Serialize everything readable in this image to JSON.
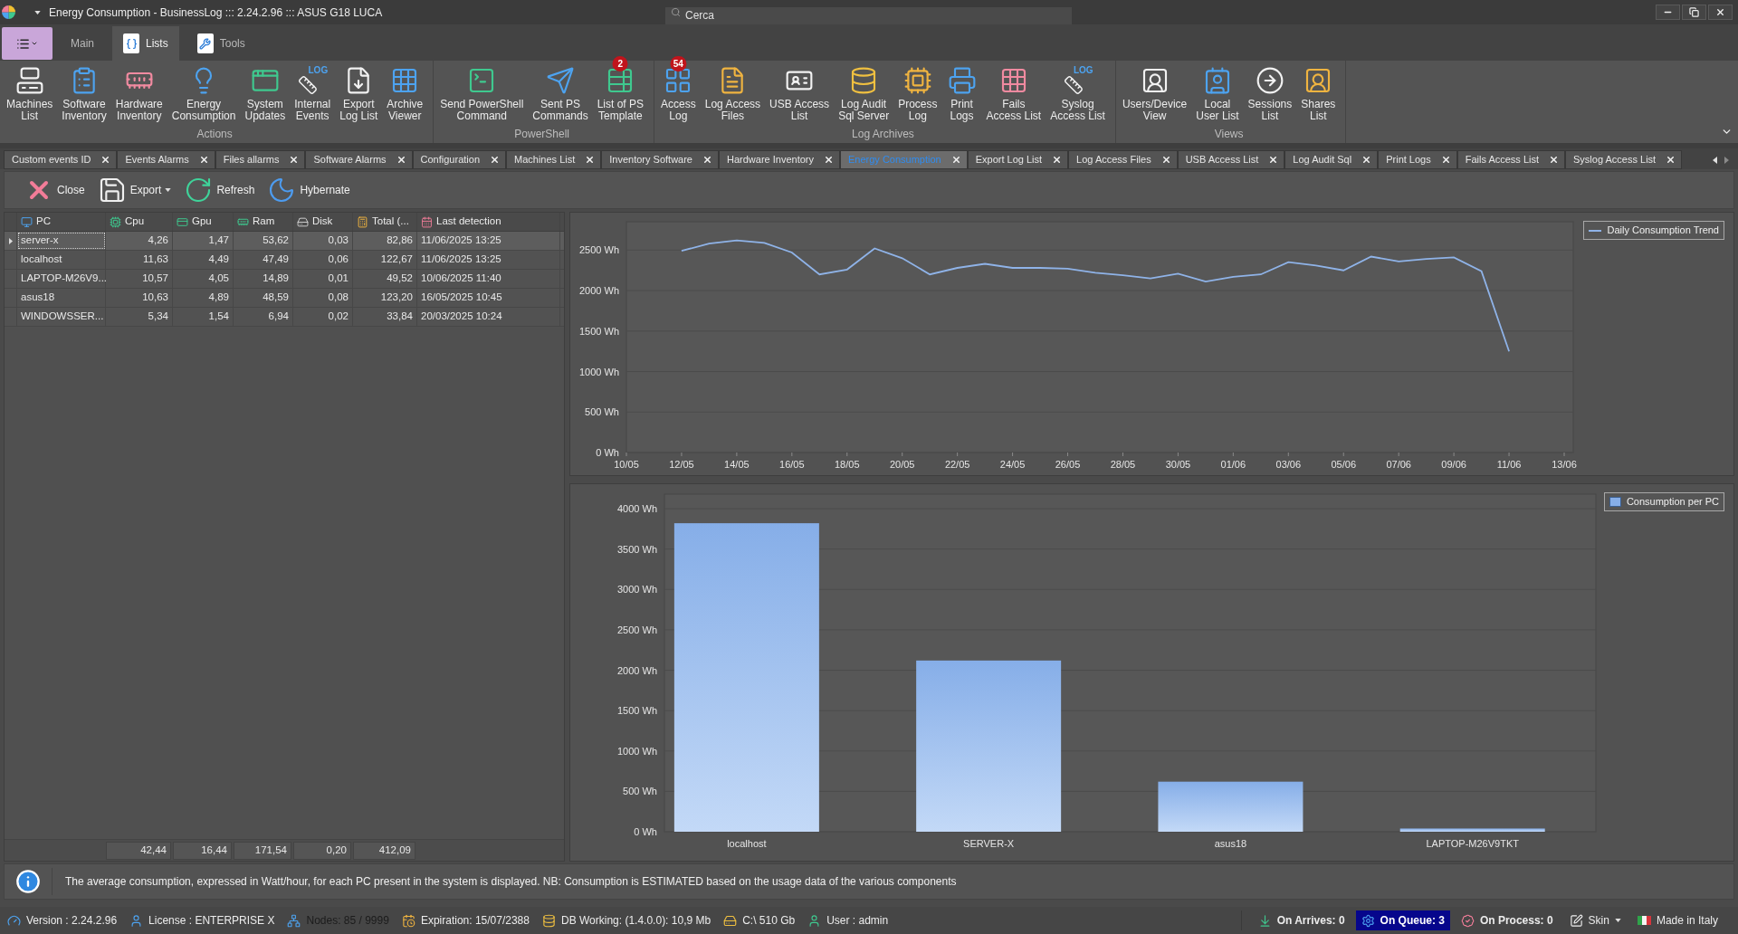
{
  "window": {
    "title": "Energy Consumption - BusinessLog ::: 2.24.2.96 ::: ASUS G18 LUCA",
    "search": {
      "placeholder": "Cerca"
    }
  },
  "ribbon": {
    "tabs": [
      {
        "label": "Main",
        "selected": false
      },
      {
        "label": "Lists",
        "selected": true
      },
      {
        "label": "Tools",
        "selected": false
      }
    ],
    "groups": [
      {
        "label": "Actions",
        "items": [
          {
            "label": "Machines\nList"
          },
          {
            "label": "Software\nInventory"
          },
          {
            "label": "Hardware\nInventory"
          },
          {
            "label": "Energy\nConsumption"
          },
          {
            "label": "System\nUpdates"
          },
          {
            "label": "Internal\nEvents",
            "icon_caption": "LOG"
          },
          {
            "label": "Export\nLog List"
          },
          {
            "label": "Archive\nViewer"
          }
        ]
      },
      {
        "label": "PowerShell",
        "items": [
          {
            "label": "Send PowerShell\nCommand"
          },
          {
            "label": "Sent PS\nCommands"
          },
          {
            "label": "List of PS\nTemplate",
            "badge": "2"
          }
        ]
      },
      {
        "label": "Log Archives",
        "items": [
          {
            "label": "Access\nLog",
            "badge": "54"
          },
          {
            "label": "Log Access\nFiles"
          },
          {
            "label": "USB Access\nList"
          },
          {
            "label": "Log Audit\nSql Server"
          },
          {
            "label": "Process\nLog"
          },
          {
            "label": "Print\nLogs"
          },
          {
            "label": "Fails\nAccess List"
          },
          {
            "label": "Syslog\nAccess List",
            "icon_caption": "LOG"
          }
        ]
      },
      {
        "label": "Views",
        "items": [
          {
            "label": "Users/Device\nView"
          },
          {
            "label": "Local\nUser List"
          },
          {
            "label": "Sessions\nList"
          },
          {
            "label": "Shares\nList"
          }
        ]
      }
    ]
  },
  "document_tabs": [
    {
      "label": "Custom events ID",
      "selected": false
    },
    {
      "label": "Events Alarms",
      "selected": false
    },
    {
      "label": "Files allarms",
      "selected": false
    },
    {
      "label": "Software Alarms",
      "selected": false
    },
    {
      "label": "Configuration",
      "selected": false
    },
    {
      "label": "Machines List",
      "selected": false
    },
    {
      "label": "Inventory Software",
      "selected": false
    },
    {
      "label": "Hardware Inventory",
      "selected": false
    },
    {
      "label": "Energy Consumption",
      "selected": true
    },
    {
      "label": "Export Log List",
      "selected": false
    },
    {
      "label": "Log Access Files",
      "selected": false
    },
    {
      "label": "USB Access List",
      "selected": false
    },
    {
      "label": "Log Audit Sql",
      "selected": false
    },
    {
      "label": "Print Logs",
      "selected": false
    },
    {
      "label": "Fails Access List",
      "selected": false
    },
    {
      "label": "Syslog Access List",
      "selected": false
    }
  ],
  "toolbar": [
    {
      "label": "Close",
      "kind": "button"
    },
    {
      "label": "Export",
      "kind": "dropdown"
    },
    {
      "label": "Refresh",
      "kind": "button"
    },
    {
      "label": "Hybernate",
      "kind": "button"
    }
  ],
  "grid": {
    "columns": [
      {
        "label": "PC"
      },
      {
        "label": "Cpu"
      },
      {
        "label": "Gpu"
      },
      {
        "label": "Ram"
      },
      {
        "label": "Disk"
      },
      {
        "label": "Total (..."
      },
      {
        "label": "Last detection"
      }
    ],
    "rows": [
      {
        "cells": [
          "server-x",
          "4,26",
          "1,47",
          "53,62",
          "0,03",
          "82,86",
          "11/06/2025 13:25"
        ],
        "selected": true
      },
      {
        "cells": [
          "localhost",
          "11,63",
          "4,49",
          "47,49",
          "0,06",
          "122,67",
          "11/06/2025 13:25"
        ],
        "selected": false
      },
      {
        "cells": [
          "LAPTOP-M26V9...",
          "10,57",
          "4,05",
          "14,89",
          "0,01",
          "49,52",
          "10/06/2025 11:40"
        ],
        "selected": false
      },
      {
        "cells": [
          "asus18",
          "10,63",
          "4,89",
          "48,59",
          "0,08",
          "123,20",
          "16/05/2025 10:45"
        ],
        "selected": false
      },
      {
        "cells": [
          "WINDOWSSER...",
          "5,34",
          "1,54",
          "6,94",
          "0,02",
          "33,84",
          "20/03/2025 10:24"
        ],
        "selected": false
      }
    ],
    "totals": [
      "42,44",
      "16,44",
      "171,54",
      "0,20",
      "412,09"
    ]
  },
  "line_chart": {
    "chart_data": {
      "type": "line",
      "categories": [
        "10/05",
        null,
        "12/05",
        null,
        "14/05",
        null,
        "16/05",
        null,
        "18/05",
        null,
        "20/05",
        null,
        "22/05",
        null,
        "24/05",
        null,
        "26/05",
        null,
        "28/05",
        null,
        "30/05",
        null,
        "01/06",
        null,
        "03/06",
        null,
        "05/06",
        null,
        "07/06",
        null,
        "09/06",
        null,
        "11/06",
        null,
        "13/06"
      ],
      "series": [
        {
          "name": "Daily Consumption Trend",
          "color": "#8fb3e8",
          "values": [
            null,
            null,
            2490,
            2580,
            2620,
            2590,
            2470,
            2200,
            2260,
            2520,
            2400,
            2200,
            2280,
            2330,
            2280,
            2280,
            2270,
            2220,
            2190,
            2150,
            2210,
            2110,
            2170,
            2200,
            2350,
            2310,
            2250,
            2420,
            2360,
            2390,
            2410,
            2240,
            1250,
            null,
            null
          ]
        }
      ],
      "ylim": [
        0,
        2850
      ],
      "yticks": [
        {
          "value": 0,
          "label": "0 Wh"
        },
        {
          "value": 500,
          "label": "500 Wh"
        },
        {
          "value": 1000,
          "label": "1000 Wh"
        },
        {
          "value": 1500,
          "label": "1500 Wh"
        },
        {
          "value": 2000,
          "label": "2000 Wh"
        },
        {
          "value": 2500,
          "label": "2500 Wh"
        }
      ],
      "grid": true
    }
  },
  "bar_chart": {
    "chart_data": {
      "type": "bar",
      "categories": [
        "localhost",
        "SERVER-X",
        "asus18",
        "LAPTOP-M26V9TKT"
      ],
      "series": [
        {
          "name": "Consumption per PC",
          "color": "#86aee8",
          "values": [
            3820,
            2120,
            620,
            40
          ]
        }
      ],
      "ylim": [
        0,
        4180
      ],
      "yticks": [
        {
          "value": 0,
          "label": "0 Wh"
        },
        {
          "value": 500,
          "label": "500 Wh"
        },
        {
          "value": 1000,
          "label": "1000 Wh"
        },
        {
          "value": 1500,
          "label": "1500 Wh"
        },
        {
          "value": 2000,
          "label": "2000 Wh"
        },
        {
          "value": 2500,
          "label": "2500 Wh"
        },
        {
          "value": 3000,
          "label": "3000 Wh"
        },
        {
          "value": 3500,
          "label": "3500 Wh"
        },
        {
          "value": 4000,
          "label": "4000 Wh"
        }
      ],
      "grid": true
    }
  },
  "info_bar": {
    "message": "The average consumption, expressed in Watt/hour, for each PC present in the system is displayed. NB: Consumption is ESTIMATED based on the usage data of the various components"
  },
  "status_bar": {
    "left": [
      {
        "text": "Version : 2.24.2.96",
        "dimmed": false
      },
      {
        "text": "License : ENTERPRISE X",
        "dimmed": false
      },
      {
        "text": "Nodes: 85 / 9999",
        "dimmed": true
      },
      {
        "text": "Expiration: 15/07/2388",
        "dimmed": false
      },
      {
        "text": "DB Working: (1.4.0.0): 10,9 Mb",
        "dimmed": false
      },
      {
        "text": "C:\\ 510 Gb",
        "dimmed": false
      },
      {
        "text": "User : admin",
        "dimmed": false
      }
    ],
    "right": [
      {
        "text": "On Arrives: 0",
        "kind": "counter",
        "highlighted": false
      },
      {
        "text": "On Queue: 3",
        "kind": "counter",
        "highlighted": true
      },
      {
        "text": "On Process: 0",
        "kind": "counter",
        "highlighted": false
      },
      {
        "text": "Skin",
        "kind": "dropdown",
        "highlighted": false
      },
      {
        "text": "Made in Italy",
        "kind": "label",
        "highlighted": false
      }
    ]
  }
}
